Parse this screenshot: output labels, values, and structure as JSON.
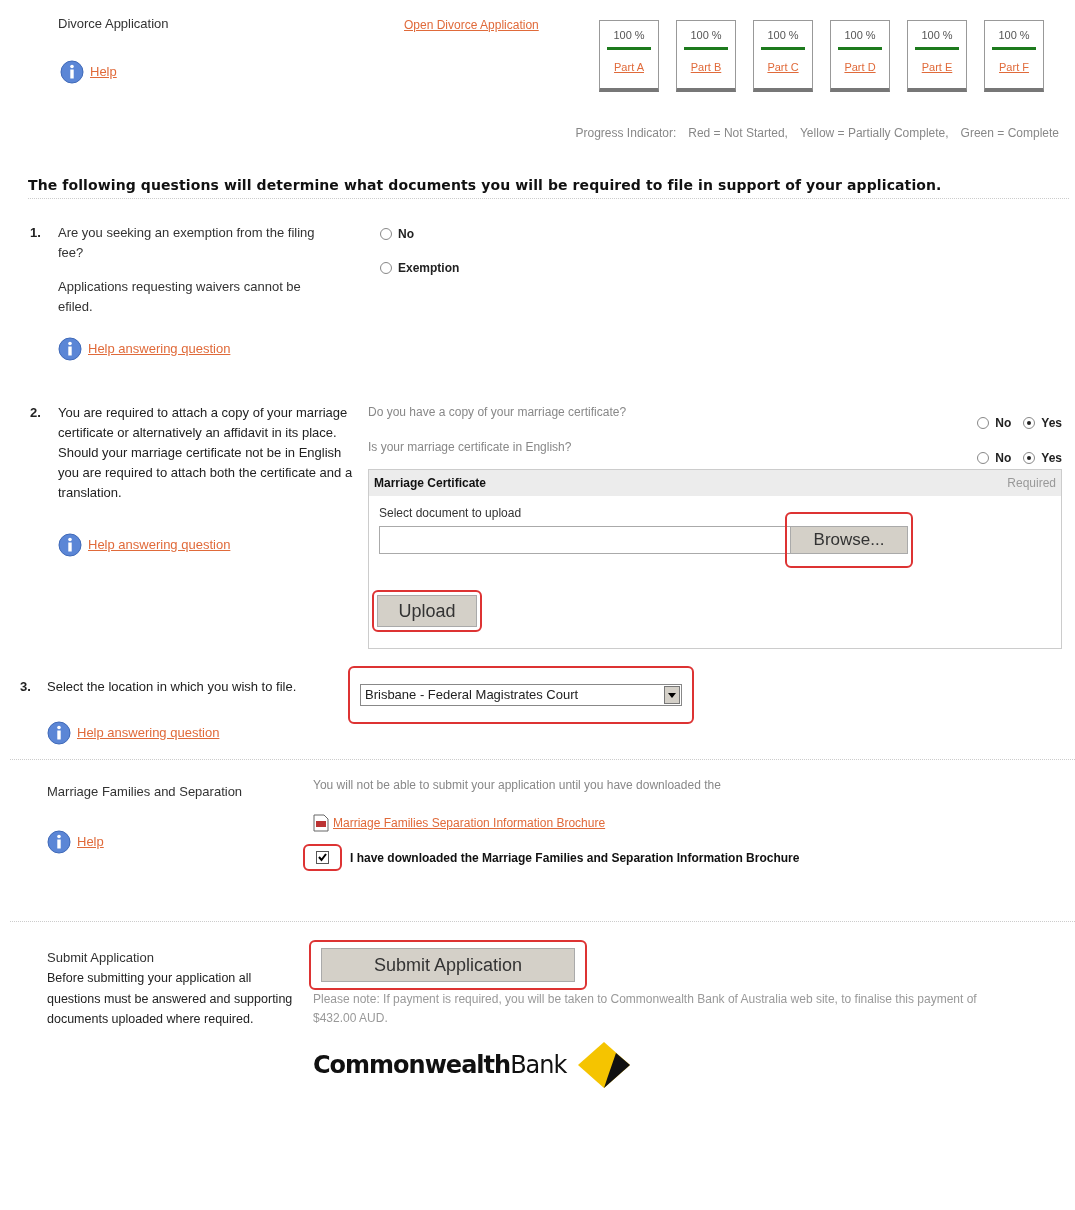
{
  "header": {
    "title": "Divorce Application",
    "help": "Help",
    "open_link": "Open Divorce Application"
  },
  "parts": [
    {
      "percent": "100 %",
      "label": "Part A",
      "color": "#1d7a1d"
    },
    {
      "percent": "100 %",
      "label": "Part B",
      "color": "#1d7a1d"
    },
    {
      "percent": "100 %",
      "label": "Part C",
      "color": "#1d7a1d"
    },
    {
      "percent": "100 %",
      "label": "Part D",
      "color": "#1d7a1d"
    },
    {
      "percent": "100 %",
      "label": "Part E",
      "color": "#1d7a1d"
    },
    {
      "percent": "100 %",
      "label": "Part F",
      "color": "#1d7a1d"
    }
  ],
  "legend": [
    "Progress Indicator:",
    "Red = Not Started,",
    "Yellow = Partially Complete,",
    "Green = Complete"
  ],
  "intro": "The following questions will determine what documents you will be required to file in support of your application.",
  "q1": {
    "number": "1.",
    "text": "Are you seeking an exemption from the filing fee?",
    "note": "Applications requesting waivers cannot be efiled.",
    "help": "Help answering question",
    "options": [
      {
        "label": "No",
        "selected": false
      },
      {
        "label": "Exemption",
        "selected": false
      }
    ]
  },
  "q2": {
    "number": "2.",
    "text": "You are required to attach a copy of your marriage certificate or alternatively an affidavit in its place. Should your marriage certificate not be in English you are required to attach both the certificate and a translation.",
    "help": "Help answering question",
    "subquestions": [
      {
        "text": "Do you have a copy of your marriage certificate?",
        "options": [
          {
            "label": "No",
            "selected": false
          },
          {
            "label": "Yes",
            "selected": true
          }
        ]
      },
      {
        "text": "Is your marriage certificate in English?",
        "options": [
          {
            "label": "No",
            "selected": false
          },
          {
            "label": "Yes",
            "selected": true
          }
        ]
      }
    ],
    "upload": {
      "title": "Marriage Certificate",
      "required": "Required",
      "label": "Select document to upload",
      "browse": "Browse...",
      "browse_highlighted": true,
      "button": "Upload",
      "button_highlighted": true
    }
  },
  "q3": {
    "number": "3.",
    "text": "Select the location in which you wish to file.",
    "select": "Brisbane - Federal Magistrates Court",
    "highlighted": true,
    "help": "Help answering question"
  },
  "brochure": {
    "title": "Marriage Families and Separation",
    "help": "Help",
    "notice": "You will not be able to submit your application until you have downloaded the",
    "link": "Marriage Families Separation Information Brochure",
    "confirm": "I have downloaded the Marriage Families and Separation Information Brochure",
    "checked": true,
    "highlighted": true
  },
  "submit": {
    "title": "Submit Application",
    "text": "Before submitting your application all questions must be answered and supporting documents uploaded where required.",
    "button": "Submit Application",
    "highlighted": true,
    "note": "Please note: If payment is required, you will be taken to Commonwealth Bank of Australia web site, to finalise this payment of $432.00 AUD.",
    "logo": "**Commonwealth**Bank"
  }
}
